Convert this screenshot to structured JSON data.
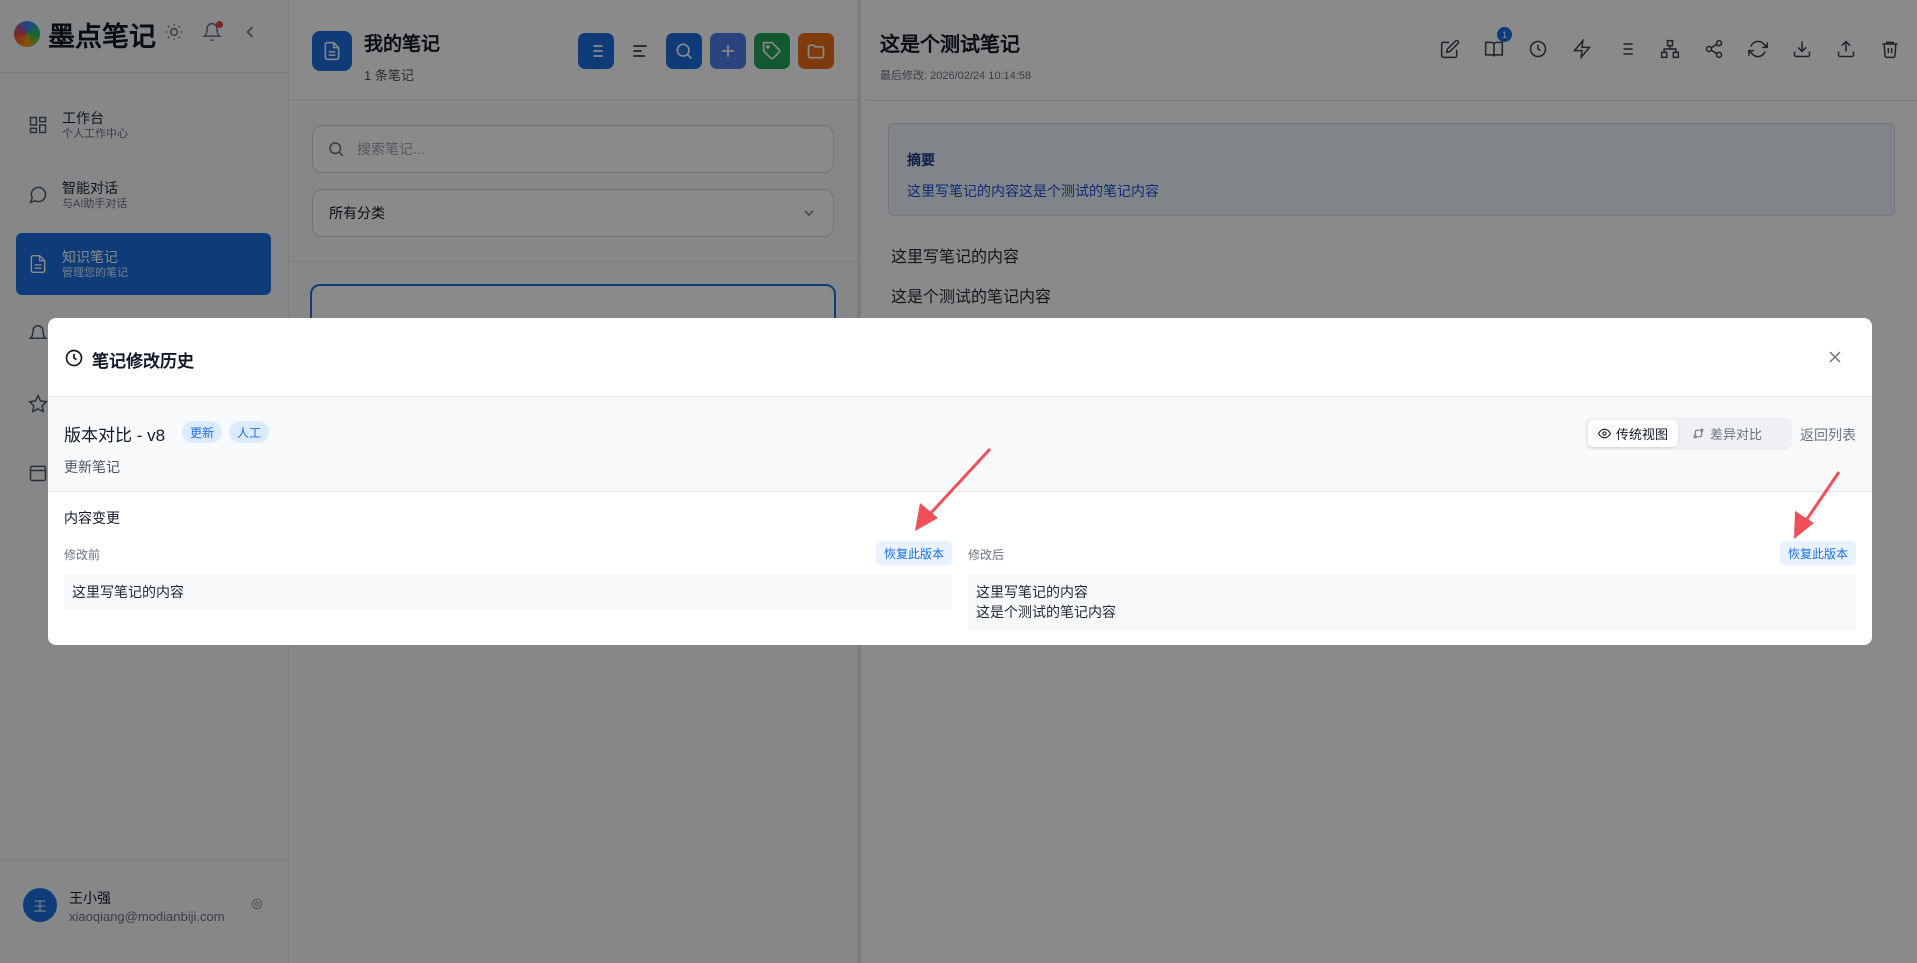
{
  "app": {
    "name": "墨点笔记"
  },
  "sidebar": {
    "items": [
      {
        "title": "工作台",
        "subtitle": "个人工作中心"
      },
      {
        "title": "智能对话",
        "subtitle": "与AI助手对话"
      },
      {
        "title": "知识笔记",
        "subtitle": "管理您的笔记"
      }
    ],
    "user": {
      "avatar_letter": "王",
      "name": "王小强",
      "email": "xiaoqiang@modianbiji.com"
    }
  },
  "list": {
    "title": "我的笔记",
    "count": "1 条笔记",
    "search_placeholder": "搜索笔记...",
    "category": "所有分类"
  },
  "editor": {
    "title": "这是个测试笔记",
    "modified": "最后修改: 2026/02/24 10:14:58",
    "history_badge": "1",
    "summary_label": "摘要",
    "summary_text": "这里写笔记的内容这是个测试的笔记内容",
    "paragraphs": [
      "这里写笔记的内容",
      "这是个测试的笔记内容"
    ]
  },
  "modal": {
    "title": "笔记修改历史",
    "version_title": "版本对比 - v8",
    "tags": [
      "更新",
      "人工"
    ],
    "version_desc": "更新笔记",
    "view_traditional": "传统视图",
    "view_diff": "差异对比",
    "back": "返回列表",
    "changes_label": "内容变更",
    "before_label": "修改前",
    "after_label": "修改后",
    "restore_label": "恢复此版本",
    "before_lines": [
      "这里写笔记的内容"
    ],
    "after_lines": [
      "这里写笔记的内容",
      "这是个测试的笔记内容"
    ]
  },
  "colors": {
    "primary": "#1d6fe0",
    "green": "#22a35a",
    "orange": "#ea6c1a",
    "arrow": "#f0505a"
  }
}
